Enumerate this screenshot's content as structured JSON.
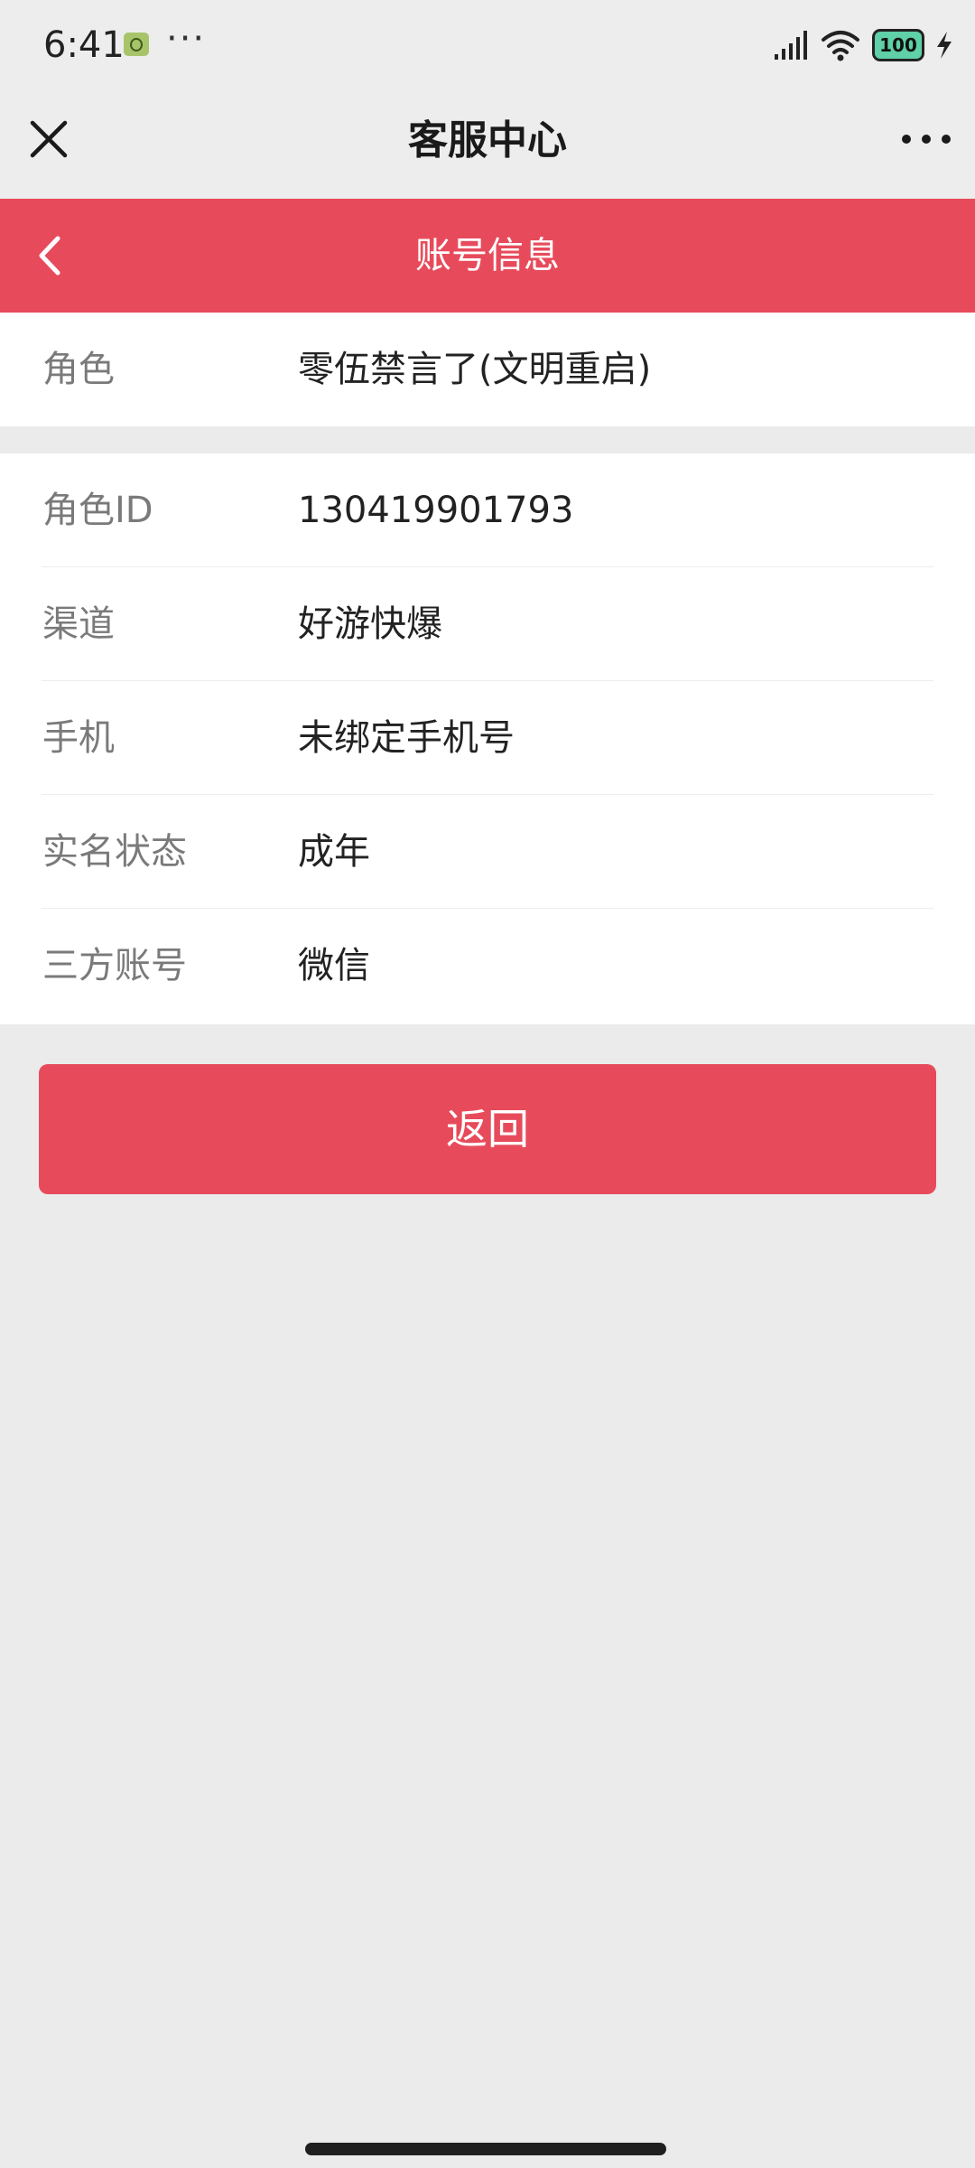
{
  "status_bar": {
    "time": "6:41",
    "more": "···",
    "battery": "100",
    "icons": [
      "signal-icon",
      "wifi-icon",
      "battery-icon",
      "charging-icon"
    ]
  },
  "nav": {
    "title": "客服中心",
    "close_icon": "close-icon",
    "more_icon": "more-dots-icon"
  },
  "header": {
    "title": "账号信息",
    "back_icon": "chevron-left-icon",
    "color": "#e74b5b"
  },
  "role_section": {
    "label": "角色",
    "value": "零伍禁言了(文明重启)"
  },
  "info_rows": [
    {
      "label": "角色ID",
      "value": "130419901793"
    },
    {
      "label": "渠道",
      "value": "好游快爆"
    },
    {
      "label": "手机",
      "value": "未绑定手机号"
    },
    {
      "label": "实名状态",
      "value": "成年"
    },
    {
      "label": "三方账号",
      "value": "微信"
    }
  ],
  "return_button": {
    "label": "返回",
    "color": "#e74b5b"
  }
}
